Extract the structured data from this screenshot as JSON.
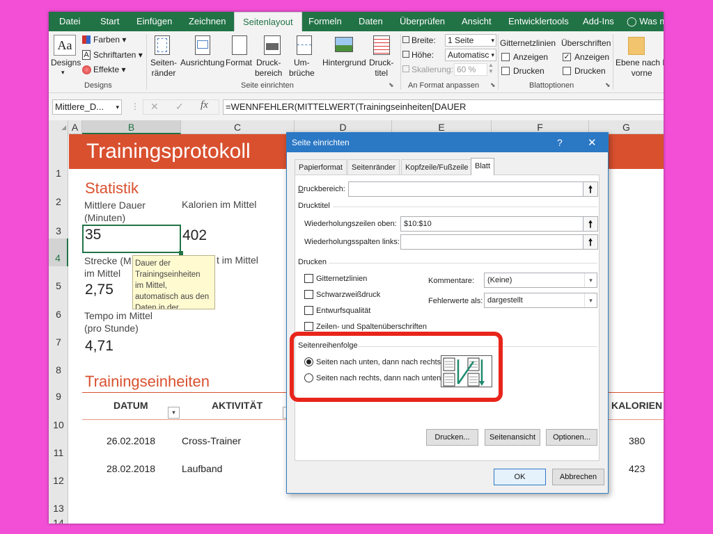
{
  "ribbon": {
    "tabs": [
      "Datei",
      "Start",
      "Einfügen",
      "Zeichnen",
      "Seitenlayout",
      "Formeln",
      "Daten",
      "Überprüfen",
      "Ansicht",
      "Entwicklertools",
      "Add-Ins",
      "Was m"
    ],
    "active_tab": "Seitenlayout",
    "designs": {
      "label": "Designs",
      "colors": "Farben",
      "fonts": "Schriftarten",
      "effects": "Effekte",
      "group": "Designs"
    },
    "page_setup": {
      "margins": "Seiten-\nränder",
      "orientation": "Ausrichtung",
      "size": "Format",
      "print_area": "Druck-\nbereich",
      "breaks": "Um-\nbrüche",
      "background": "Hintergrund",
      "print_titles": "Druck-\ntitel",
      "group": "Seite einrichten"
    },
    "scale": {
      "width_label": "Breite:",
      "width_value": "1 Seite",
      "height_label": "Höhe:",
      "height_value": "Automatisc",
      "scaling_label": "Skalierung:",
      "scaling_value": "60 %",
      "group": "An Format anpassen"
    },
    "sheet_options": {
      "gridlines": "Gitternetzlinien",
      "headings": "Überschriften",
      "view": "Anzeigen",
      "print": "Drucken",
      "group": "Blattoptionen",
      "gridlines_view": false,
      "gridlines_print": false,
      "headings_view": true,
      "headings_print": false
    },
    "arrange": {
      "bring_forward": "Ebene nach E\nvorne"
    }
  },
  "formula_bar": {
    "name_box": "Mittlere_D...",
    "formula": "=WENNFEHLER(MITTELWERT(Trainingseinheiten[DAUER",
    "fx": "fx"
  },
  "sheet": {
    "columns": [
      "A",
      "B",
      "C",
      "D",
      "E",
      "F",
      "G"
    ],
    "rows": [
      "1",
      "2",
      "3",
      "4",
      "5",
      "6",
      "7",
      "8",
      "9",
      "10",
      "11",
      "12",
      "13",
      "14"
    ],
    "title": "Trainingsprotokoll",
    "statistik": "Statistik",
    "avg_duration_label": "Mittlere Dauer\n(Minuten)",
    "avg_duration_value": "35",
    "avg_calories_label": "Kalorien im Mittel",
    "avg_calories_value": "402",
    "avg_distance_label": "Strecke (M\nim Mittel",
    "avg_distance_value": "2,75",
    "partial_label": "t im Mittel",
    "avg_pace_label": "Tempo im Mittel\n(pro Stunde)",
    "avg_pace_value": "4,71",
    "tooltip": "Dauer der\nTrainingseinheiten\nim Mittel,\nautomatisch aus den\nDaten in der",
    "sessions_heading": "Trainingseinheiten",
    "table_headers": {
      "date": "DATUM",
      "activity": "AKTIVITÄT",
      "calories": "KALORIEN"
    },
    "table_rows": [
      {
        "date": "26.02.2018",
        "activity": "Cross-Trainer",
        "calories": "380"
      },
      {
        "date": "28.02.2018",
        "activity": "Laufband",
        "calories": "423"
      }
    ],
    "accent": "#d9502f"
  },
  "dialog": {
    "title": "Seite einrichten",
    "help": "?",
    "close": "✕",
    "tabs": [
      "Papierformat",
      "Seitenränder",
      "Kopfzeile/Fußzeile",
      "Blatt"
    ],
    "active_tab": "Blatt",
    "print_area_label": "Druckbereich:",
    "print_area_value": "",
    "print_titles_label": "Drucktitel",
    "rows_repeat_label": "Wiederholungszeilen oben:",
    "rows_repeat_value": "$10:$10",
    "cols_repeat_label": "Wiederholungsspalten links:",
    "cols_repeat_value": "",
    "print_section": "Drucken",
    "gridlines": "Gitternetzlinien",
    "black_white": "Schwarzweißdruck",
    "draft": "Entwurfsqualität",
    "row_col_headings": "Zeilen- und Spaltenüberschriften",
    "comments_label": "Kommentare:",
    "comments_value": "(Keine)",
    "errors_label": "Fehlerwerte als:",
    "errors_value": "dargestellt",
    "page_order_label": "Seitenreihenfolge",
    "order_down_then_over": "Seiten nach unten, dann nach rechts",
    "order_over_then_down": "Seiten nach rechts, dann nach unten",
    "selected_order": "down_then_over",
    "print_button": "Drucken...",
    "preview_button": "Seitenansicht",
    "options_button": "Optionen...",
    "ok_button": "OK",
    "cancel_button": "Abbrechen",
    "highlight_color": "#e8251b"
  }
}
